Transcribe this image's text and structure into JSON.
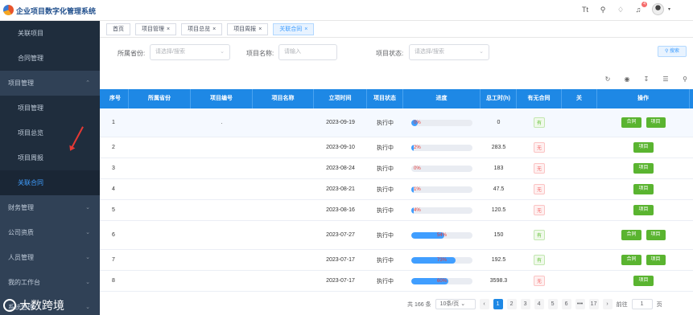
{
  "app": {
    "title": "企业项目数字化管理系统"
  },
  "header": {
    "notification_count": "4"
  },
  "sidebar": {
    "items": [
      {
        "label": "关联项目",
        "level": "sub"
      },
      {
        "label": "合同管理",
        "level": "sub"
      },
      {
        "label": "项目管理",
        "level": "group",
        "caret": "^"
      },
      {
        "label": "项目管理",
        "level": "sub"
      },
      {
        "label": "项目总览",
        "level": "sub"
      },
      {
        "label": "项目周报",
        "level": "sub"
      },
      {
        "label": "关联合同",
        "level": "sub",
        "active": true
      },
      {
        "label": "财务管理",
        "level": "group",
        "caret": "v"
      },
      {
        "label": "公司资质",
        "level": "group",
        "caret": "v"
      },
      {
        "label": "人员管理",
        "level": "group",
        "caret": "v"
      },
      {
        "label": "我的工作台",
        "level": "group",
        "caret": "v"
      },
      {
        "label": "系统管理",
        "level": "group",
        "caret": "v"
      }
    ],
    "watermark": "大数跨境"
  },
  "tabs": [
    {
      "label": "首页",
      "closable": false
    },
    {
      "label": "项目管理",
      "closable": true
    },
    {
      "label": "项目总览",
      "closable": true
    },
    {
      "label": "项目周报",
      "closable": true
    },
    {
      "label": "关联合同",
      "closable": true,
      "active": true
    }
  ],
  "filters": {
    "province_label": "所属省份:",
    "province_placeholder": "请选择/搜索",
    "name_label": "项目名称:",
    "name_placeholder": "请输入",
    "status_label": "项目状态:",
    "status_placeholder": "请选择/搜索",
    "search_button": "搜索"
  },
  "table": {
    "headers": [
      "序号",
      "所属省份",
      "项目编号",
      "项目名称",
      "立项时间",
      "项目状态",
      "进度",
      "总工时(h)",
      "有无合同",
      "关",
      "操作"
    ],
    "rows": [
      {
        "idx": "1",
        "code": ".",
        "date": "2023-09-19",
        "status": "执行中",
        "progress_text": "0%",
        "progress": 0,
        "hours": "0",
        "contract": "有",
        "has_contract": true,
        "ops": [
          "合同",
          "项目"
        ]
      },
      {
        "idx": "2",
        "code": "",
        "date": "2023-09-10",
        "status": "执行中",
        "progress_text": "2%",
        "progress": 2,
        "hours": "283.5",
        "contract": "无",
        "has_contract": false,
        "ops": [
          "项目"
        ]
      },
      {
        "idx": "3",
        "code": "",
        "date": "2023-08-24",
        "status": "执行中",
        "progress_text": "0%",
        "progress": 0,
        "hours": "183",
        "contract": "无",
        "has_contract": false,
        "ops": [
          "项目"
        ]
      },
      {
        "idx": "4",
        "code": "",
        "date": "2023-08-21",
        "status": "执行中",
        "progress_text": "1%",
        "progress": 1,
        "hours": "47.5",
        "contract": "无",
        "has_contract": false,
        "ops": [
          "项目"
        ]
      },
      {
        "idx": "5",
        "code": "",
        "date": "2023-08-16",
        "status": "执行中",
        "progress_text": "4%",
        "progress": 4,
        "hours": "120.5",
        "contract": "无",
        "has_contract": false,
        "ops": [
          "项目"
        ]
      },
      {
        "idx": "6",
        "code": "",
        "date": "2023-07-27",
        "status": "执行中",
        "progress_text": "54%",
        "progress": 54,
        "hours": "150",
        "contract": "有",
        "has_contract": true,
        "ops": [
          "合同",
          "项目"
        ]
      },
      {
        "idx": "7",
        "code": "",
        "date": "2023-07-17",
        "status": "执行中",
        "progress_text": "73%",
        "progress": 73,
        "hours": "192.5",
        "contract": "有",
        "has_contract": true,
        "ops": [
          "合同",
          "项目"
        ]
      },
      {
        "idx": "8",
        "code": "",
        "date": "2023-07-17",
        "status": "执行中",
        "progress_text": "60%",
        "progress": 60,
        "hours": "3598.3",
        "contract": "无",
        "has_contract": false,
        "ops": [
          "项目"
        ]
      }
    ]
  },
  "pagination": {
    "total": "共 166 条",
    "page_size": "10条/页",
    "pages": [
      "1",
      "2",
      "3",
      "4",
      "5",
      "6",
      "•••",
      "17"
    ],
    "current": "1",
    "goto_label": "前往",
    "goto_value": "1",
    "goto_suffix": "页"
  },
  "colors": {
    "primary": "#1e88e5",
    "sidebar_bg": "#304156",
    "success": "#5ab430",
    "danger": "#f56c6c"
  }
}
